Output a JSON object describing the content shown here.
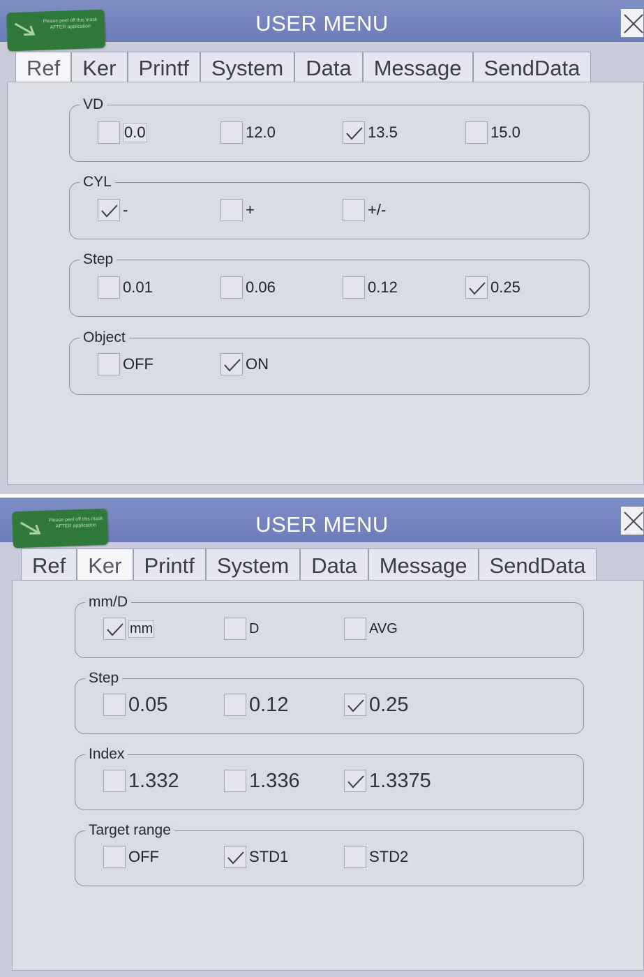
{
  "sticker": {
    "text": "Please peel off this mask AFTER application"
  },
  "screen1": {
    "title": "USER MENU",
    "tabs": [
      "Ref",
      "Ker",
      "Printf",
      "System",
      "Data",
      "Message",
      "SendData"
    ],
    "active_tab": "Ref",
    "groups": [
      {
        "legend": "VD",
        "options": [
          {
            "label": "0.0",
            "checked": false
          },
          {
            "label": "12.0",
            "checked": false
          },
          {
            "label": "13.5",
            "checked": true
          },
          {
            "label": "15.0",
            "checked": false
          }
        ]
      },
      {
        "legend": "CYL",
        "options": [
          {
            "label": "-",
            "checked": true
          },
          {
            "label": "+",
            "checked": false
          },
          {
            "label": "+/-",
            "checked": false
          }
        ]
      },
      {
        "legend": "Step",
        "options": [
          {
            "label": "0.01",
            "checked": false
          },
          {
            "label": "0.06",
            "checked": false
          },
          {
            "label": "0.12",
            "checked": false
          },
          {
            "label": "0.25",
            "checked": true
          }
        ]
      },
      {
        "legend": "Object",
        "options": [
          {
            "label": "OFF",
            "checked": false
          },
          {
            "label": "ON",
            "checked": true
          }
        ]
      }
    ]
  },
  "screen2": {
    "title": "USER MENU",
    "tabs": [
      "Ref",
      "Ker",
      "Printf",
      "System",
      "Data",
      "Message",
      "SendData"
    ],
    "active_tab": "Ker",
    "groups": [
      {
        "legend": "mm/D",
        "options": [
          {
            "label": "mm",
            "checked": true
          },
          {
            "label": "D",
            "checked": false
          },
          {
            "label": "AVG",
            "checked": false
          }
        ]
      },
      {
        "legend": "Step",
        "options": [
          {
            "label": "0.05",
            "checked": false
          },
          {
            "label": "0.12",
            "checked": false
          },
          {
            "label": "0.25",
            "checked": true
          }
        ]
      },
      {
        "legend": "Index",
        "options": [
          {
            "label": "1.332",
            "checked": false
          },
          {
            "label": "1.336",
            "checked": false
          },
          {
            "label": "1.3375",
            "checked": true
          }
        ]
      },
      {
        "legend": "Target range",
        "options": [
          {
            "label": "OFF",
            "checked": false
          },
          {
            "label": "STD1",
            "checked": true
          },
          {
            "label": "STD2",
            "checked": false
          }
        ]
      }
    ]
  },
  "colors": {
    "titlebar": "#7584be",
    "panel": "#dcdee6",
    "sticker": "#2f7a3a"
  }
}
